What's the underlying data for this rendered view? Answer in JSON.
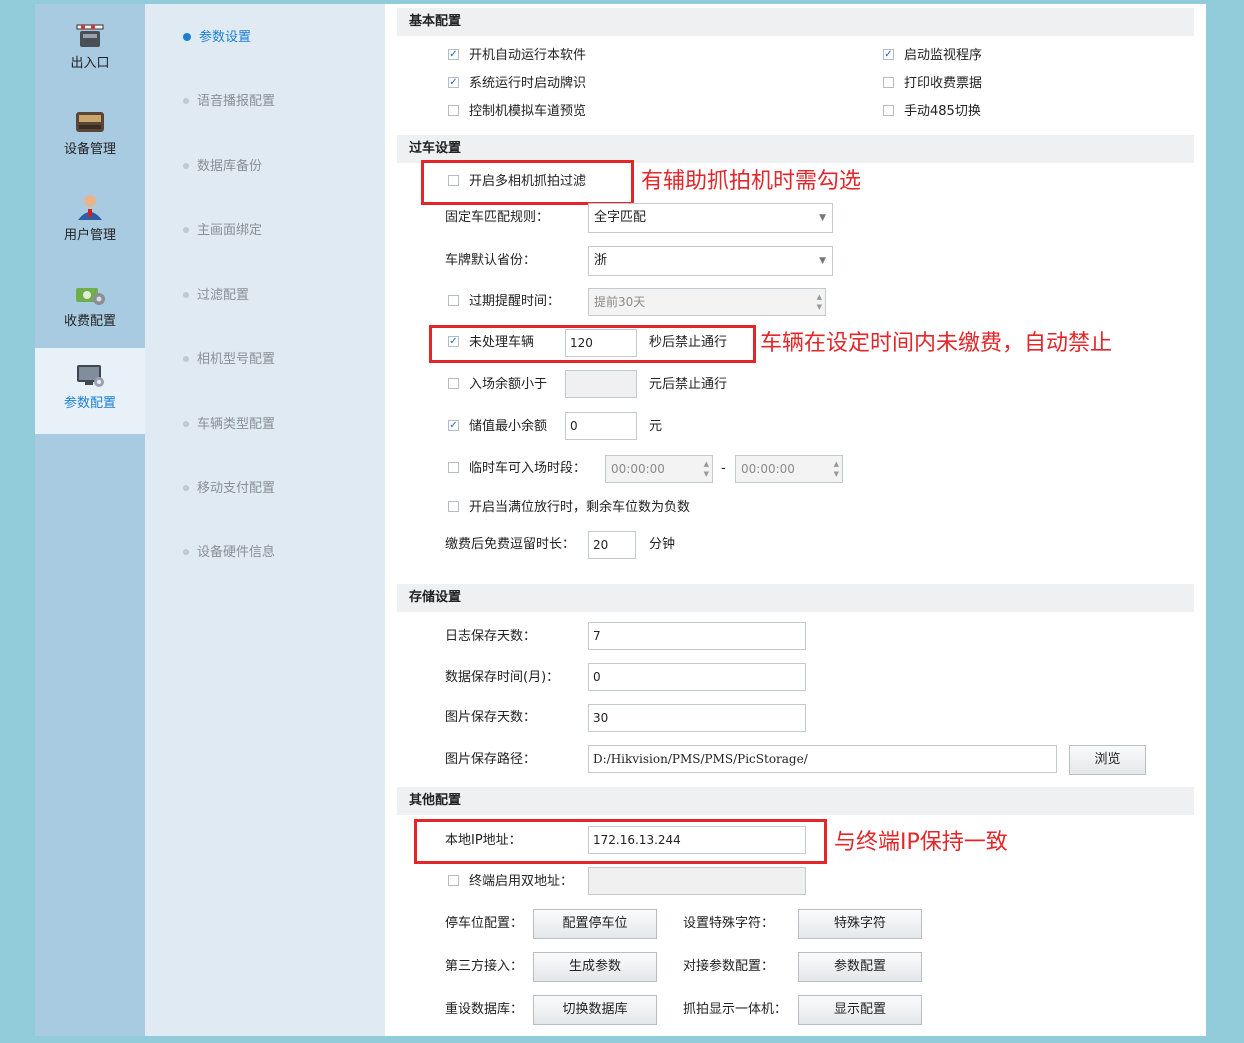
{
  "left_nav": [
    {
      "label": "出入口",
      "icon": "barrier-gate-icon"
    },
    {
      "label": "设备管理",
      "icon": "device-icon"
    },
    {
      "label": "用户管理",
      "icon": "user-icon"
    },
    {
      "label": "收费配置",
      "icon": "charge-icon"
    },
    {
      "label": "参数配置",
      "icon": "monitor-settings-icon",
      "active": true
    }
  ],
  "sub_nav": [
    {
      "label": "参数设置",
      "active": true
    },
    {
      "label": "语音播报配置"
    },
    {
      "label": "数据库备份"
    },
    {
      "label": "主画面绑定"
    },
    {
      "label": "过滤配置"
    },
    {
      "label": "相机型号配置"
    },
    {
      "label": "车辆类型配置"
    },
    {
      "label": "移动支付配置"
    },
    {
      "label": "设备硬件信息"
    }
  ],
  "basic": {
    "title": "基本配置",
    "auto_run": {
      "label": "开机自动运行本软件",
      "checked": true
    },
    "monitor": {
      "label": "启动监视程序",
      "checked": true
    },
    "recognize": {
      "label": "系统运行时启动牌识",
      "checked": true
    },
    "print_receipt": {
      "label": "打印收费票据",
      "checked": false
    },
    "simulate": {
      "label": "控制机模拟车道预览",
      "checked": false
    },
    "manual485": {
      "label": "手动485切换",
      "checked": false
    }
  },
  "pass": {
    "title": "过车设置",
    "multi_camera": {
      "label": "开启多相机抓拍过滤",
      "checked": false
    },
    "match_rule": {
      "label": "固定车匹配规则：",
      "value": "全字匹配"
    },
    "province": {
      "label": "车牌默认省份：",
      "value": "浙"
    },
    "expire": {
      "label": "过期提醒时间：",
      "value": "提前30天",
      "checked": false
    },
    "unprocessed": {
      "label": "未处理车辆",
      "value": "120",
      "suffix": "秒后禁止通行",
      "checked": true
    },
    "balance_entry": {
      "label": "入场余额小于",
      "value": "",
      "suffix": "元后禁止通行",
      "checked": false
    },
    "min_balance": {
      "label": "储值最小余额",
      "value": "0",
      "suffix": "元",
      "checked": true
    },
    "temp_time": {
      "label": "临时车可入场时段：",
      "start": "00:00:00",
      "end": "00:00:00",
      "dash": "-",
      "checked": false
    },
    "full_release": {
      "label": "开启当满位放行时，剩余车位数为负数",
      "checked": false
    },
    "free_stay": {
      "label": "缴费后免费逗留时长：",
      "value": "20",
      "suffix": "分钟"
    }
  },
  "storage": {
    "title": "存储设置",
    "log_days": {
      "label": "日志保存天数：",
      "value": "7"
    },
    "data_months": {
      "label": "数据保存时间(月)：",
      "value": "0"
    },
    "pic_days": {
      "label": "图片保存天数：",
      "value": "30"
    },
    "pic_path": {
      "label": "图片保存路径：",
      "value": "D:/Hikvision/PMS/PMS/PicStorage/",
      "browse": "浏览"
    }
  },
  "other": {
    "title": "其他配置",
    "local_ip": {
      "label": "本地IP地址：",
      "value": "172.16.13.244"
    },
    "dual_addr": {
      "label": "终端启用双地址：",
      "value": "",
      "checked": false
    },
    "parking": {
      "label": "停车位配置：",
      "button": "配置停车位"
    },
    "special": {
      "label": "设置特殊字符：",
      "button": "特殊字符"
    },
    "third": {
      "label": "第三方接入：",
      "button": "生成参数"
    },
    "docking": {
      "label": "对接参数配置：",
      "button": "参数配置"
    },
    "resetdb": {
      "label": "重设数据库：",
      "button": "切换数据库"
    },
    "capture": {
      "label": "抓拍显示一体机：",
      "button": "显示配置"
    }
  },
  "annotations": {
    "multi_camera": "有辅助抓拍机时需勾选",
    "unprocessed": "车辆在设定时间内未缴费，自动禁止",
    "local_ip": "与终端IP保持一致"
  },
  "colors": {
    "accent": "#1b7fd4",
    "annotation": "#e3262a",
    "frame": "#92cbd9",
    "left_nav_bg": "#a9cbe2"
  }
}
